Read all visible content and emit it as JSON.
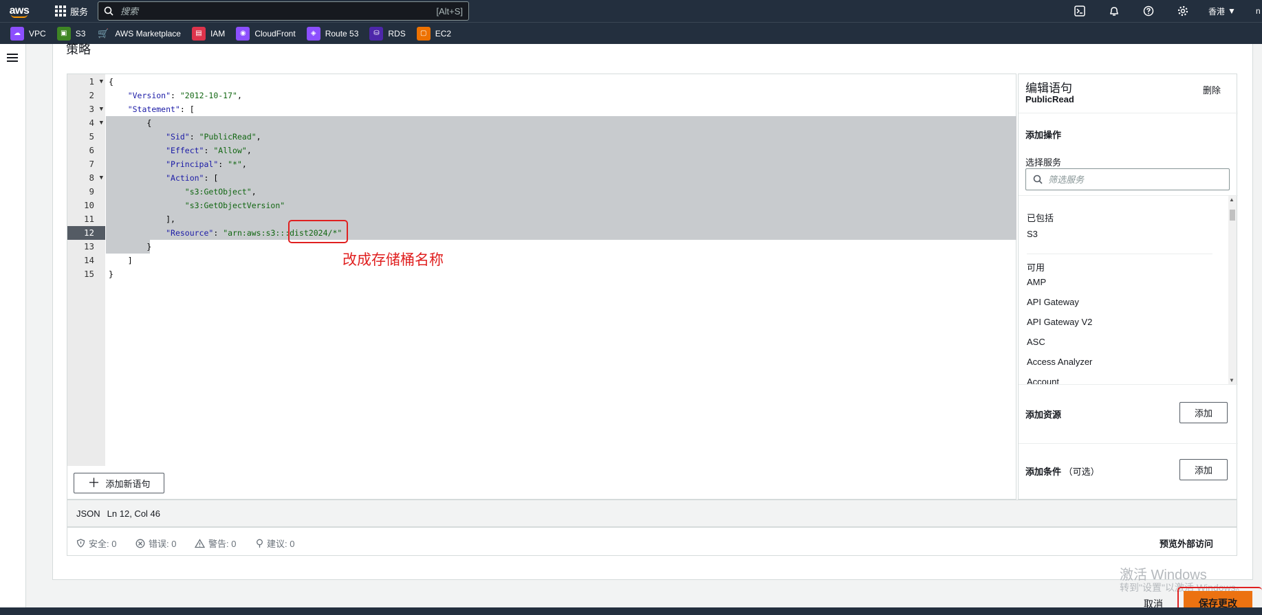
{
  "topnav": {
    "logo": "aws",
    "services_label": "服务",
    "search_placeholder": "搜索",
    "search_shortcut": "[Alt+S]",
    "region": "香港",
    "user": "n"
  },
  "favorites": [
    {
      "label": "VPC",
      "color": "#8c4fff"
    },
    {
      "label": "S3",
      "color": "#3f8624"
    },
    {
      "label": "AWS Marketplace",
      "color": "#232f3e"
    },
    {
      "label": "IAM",
      "color": "#dd344c"
    },
    {
      "label": "CloudFront",
      "color": "#8c4fff"
    },
    {
      "label": "Route 53",
      "color": "#8c4fff"
    },
    {
      "label": "RDS",
      "color": "#4d27aa"
    },
    {
      "label": "EC2",
      "color": "#ed7100"
    }
  ],
  "section_title": "策略",
  "editor": {
    "line_numbers": [
      "1",
      "2",
      "3",
      "4",
      "5",
      "6",
      "7",
      "8",
      "9",
      "10",
      "11",
      "12",
      "13",
      "14",
      "15"
    ],
    "active_line": 12,
    "annotation": "改成存储桶名称",
    "add_statement_label": "添加新语句",
    "code": {
      "l1": "{",
      "l2_key": "\"Version\"",
      "l2_val": "\"2012-10-17\"",
      "l3_key": "\"Statement\"",
      "l3_rest": ": [",
      "l4": "{",
      "l5_key": "\"Sid\"",
      "l5_val": "\"PublicRead\"",
      "l6_key": "\"Effect\"",
      "l6_val": "\"Allow\"",
      "l7_key": "\"Principal\"",
      "l7_val": "\"*\"",
      "l8_key": "\"Action\"",
      "l8_rest": ": [",
      "l9_val": "\"s3:GetObject\"",
      "l10_val": "\"s3:GetObjectVersion\"",
      "l11": "],",
      "l12_key": "\"Resource\"",
      "l12_val": "\"arn:aws:s3:::dist2024/*\"",
      "l13": "}",
      "l14": "]",
      "l15": "}"
    }
  },
  "right_panel": {
    "title": "编辑语句",
    "statement_id": "PublicRead",
    "delete_label": "删除",
    "add_action_heading": "添加操作",
    "select_service_label": "选择服务",
    "filter_placeholder": "筛选服务",
    "included_heading": "已包括",
    "included": [
      "S3"
    ],
    "available_heading": "可用",
    "available": [
      "AMP",
      "API Gateway",
      "API Gateway V2",
      "ASC",
      "Access Analyzer",
      "Account"
    ],
    "add_resource_heading": "添加资源",
    "add_resource_button": "添加",
    "add_condition_heading": "添加条件",
    "add_condition_optional": "（可选）",
    "add_condition_button": "添加"
  },
  "statusbar": {
    "mode": "JSON",
    "position": "Ln 12, Col 46"
  },
  "issues": {
    "security": "安全: 0",
    "errors": "错误: 0",
    "warnings": "警告: 0",
    "suggestions": "建议: 0",
    "preview_label": "预览外部访问"
  },
  "watermark": {
    "line1": "激活 Windows",
    "line2": "转到\"设置\"以激活 Windows。"
  },
  "footer": {
    "cancel_label": "取消",
    "save_label": "保存更改"
  }
}
